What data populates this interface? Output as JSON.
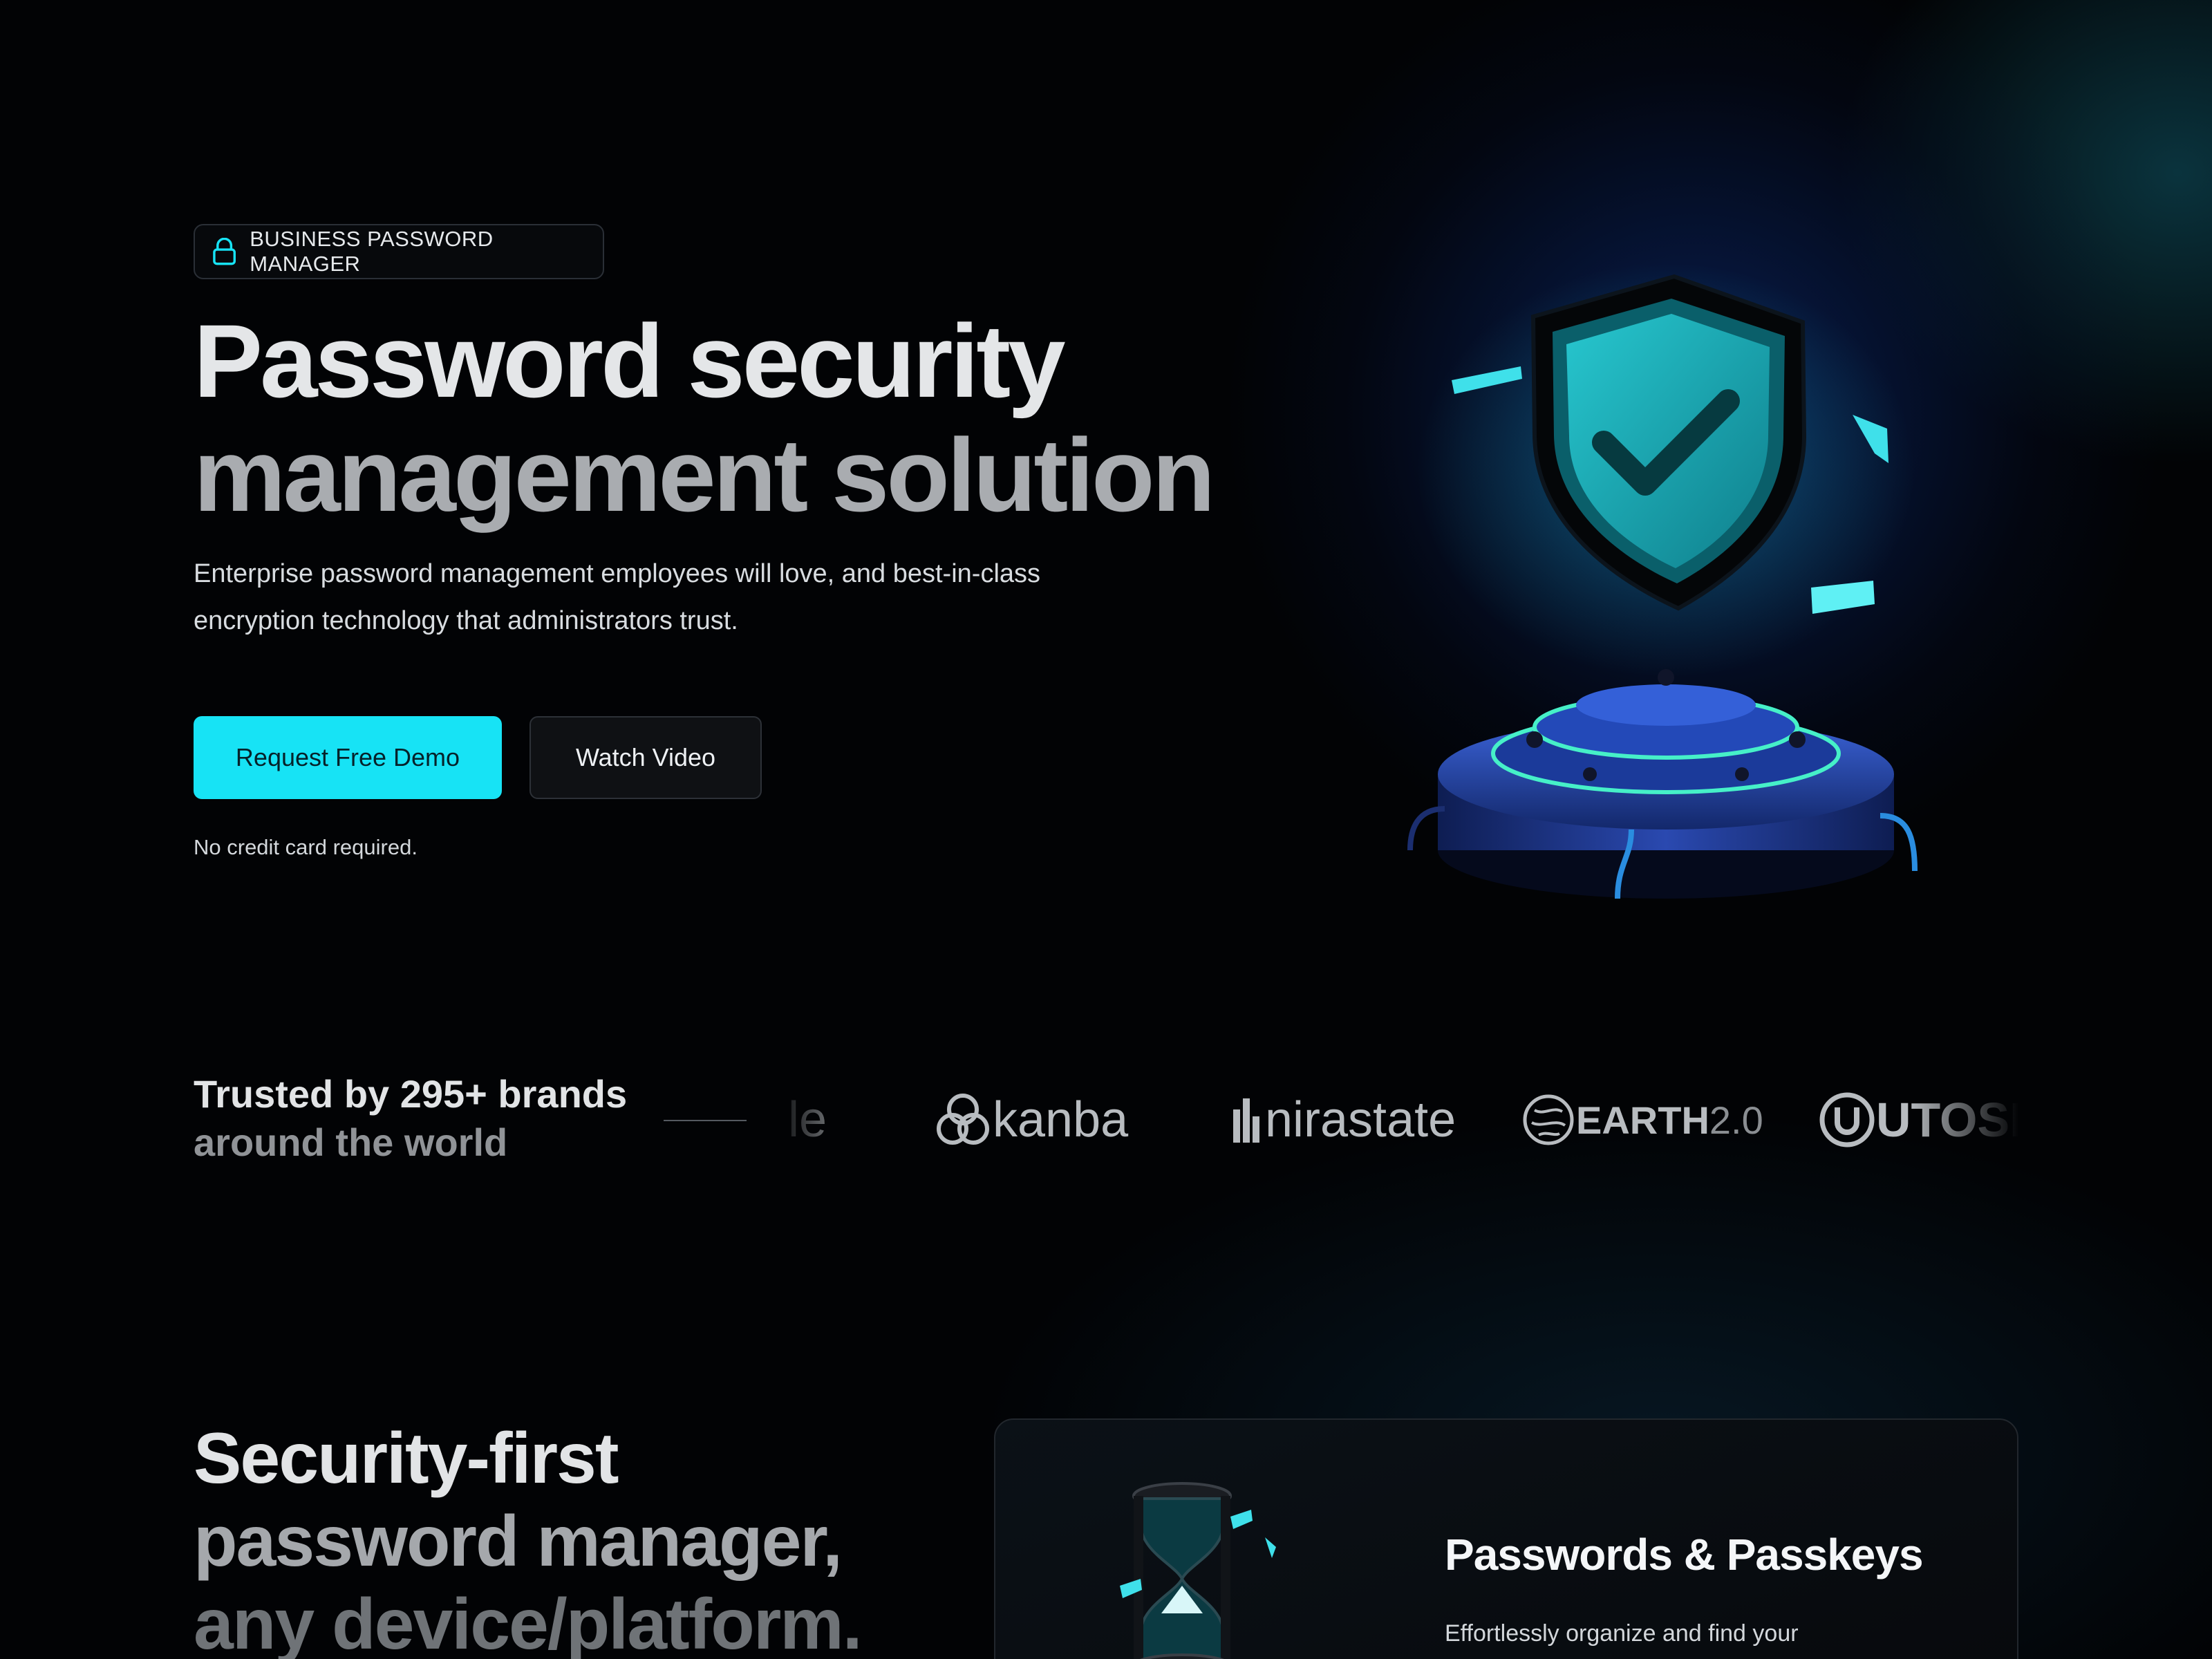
{
  "hero": {
    "badge_label": "BUSINESS PASSWORD MANAGER",
    "title_line1": "Password security",
    "title_line2": "management solution",
    "subtitle": "Enterprise password management employees will love, and best-in-class encryption technology that administrators trust.",
    "primary_cta": "Request Free Demo",
    "secondary_cta": "Watch Video",
    "note": "No credit card required."
  },
  "trusted": {
    "line1": "Trusted by 295+ brands",
    "line2": "around the world",
    "logos": {
      "partial": "le",
      "kanba": "kanba",
      "nirastate": "nirastate",
      "earth_bold": "EARTH",
      "earth_version": "2.0",
      "utosia": "UTOSI"
    }
  },
  "section": {
    "title_line1": "Security-first",
    "title_line2": "password manager,",
    "title_line3": "any device/platform."
  },
  "feature_card": {
    "title": "Passwords & Passkeys",
    "description": "Effortlessly organize and find your"
  },
  "colors": {
    "accent": "#17e3f5",
    "background": "#020305",
    "shield": "#1aa9b3"
  },
  "icons": [
    "lock-icon",
    "shield-check-icon",
    "hourglass-icon",
    "kanba-logo-icon",
    "nirastate-logo-icon",
    "earth-logo-icon",
    "utosia-logo-icon"
  ]
}
